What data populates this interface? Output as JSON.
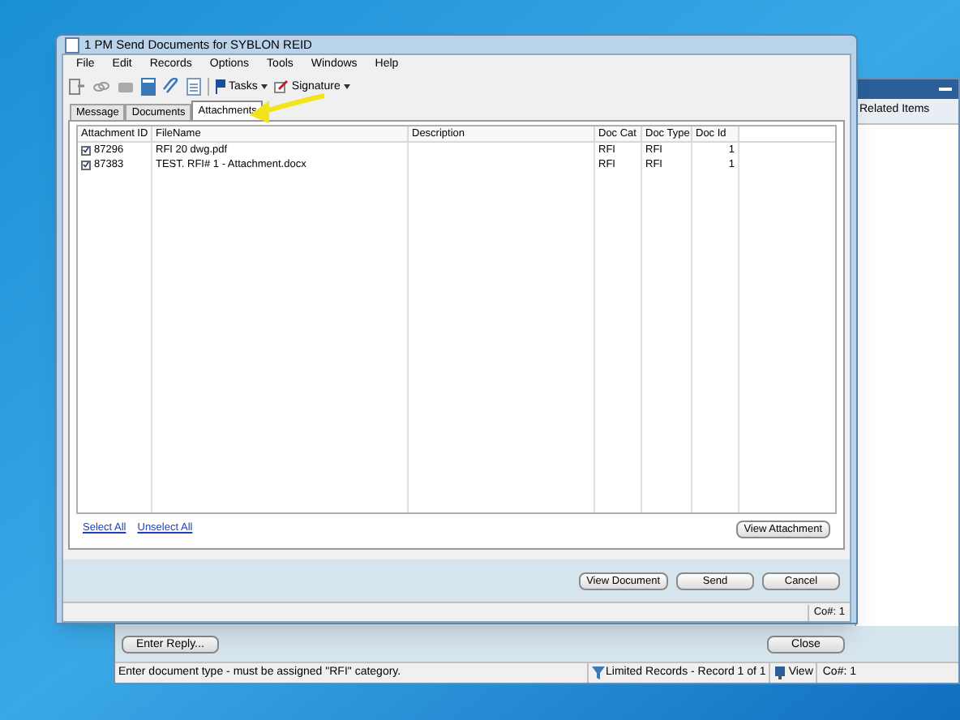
{
  "dialog": {
    "title": "1 PM Send Documents for SYBLON REID",
    "menu": [
      "File",
      "Edit",
      "Records",
      "Options",
      "Tools",
      "Windows",
      "Help"
    ],
    "toolbar": [
      {
        "label": "Tasks",
        "kind": "tasks"
      },
      {
        "label": "Signature",
        "kind": "signature"
      }
    ],
    "tabs": [
      {
        "label": "Message",
        "selected": false
      },
      {
        "label": "Documents",
        "selected": false
      },
      {
        "label": "Attachments",
        "selected": true
      }
    ],
    "table": {
      "columns": [
        "Attachment ID",
        "FileName",
        "Description",
        "Doc Cat",
        "Doc Type",
        "Doc Id"
      ],
      "rows": [
        {
          "checked": true,
          "cells": [
            "87296",
            "RFI 20 dwg.pdf",
            "",
            "RFI",
            "RFI",
            "1"
          ]
        },
        {
          "checked": true,
          "cells": [
            "87383",
            "TEST. RFI# 1 - Attachment.docx",
            "",
            "RFI",
            "RFI",
            "1"
          ]
        }
      ]
    },
    "links": [
      "Select All",
      "Unselect All"
    ],
    "view_attachment": "View Attachment",
    "buttons": [
      "View Document",
      "Send",
      "Cancel"
    ],
    "status": "Co#: 1"
  },
  "back_window": {
    "panel_title": "Related Items",
    "enter_reply": "Enter Reply...",
    "close": "Close",
    "status_message": "Enter document type - must be assigned \"RFI\" category.",
    "records": "Limited Records - Record 1 of 1",
    "view": "View",
    "status_co": "Co#: 1"
  }
}
